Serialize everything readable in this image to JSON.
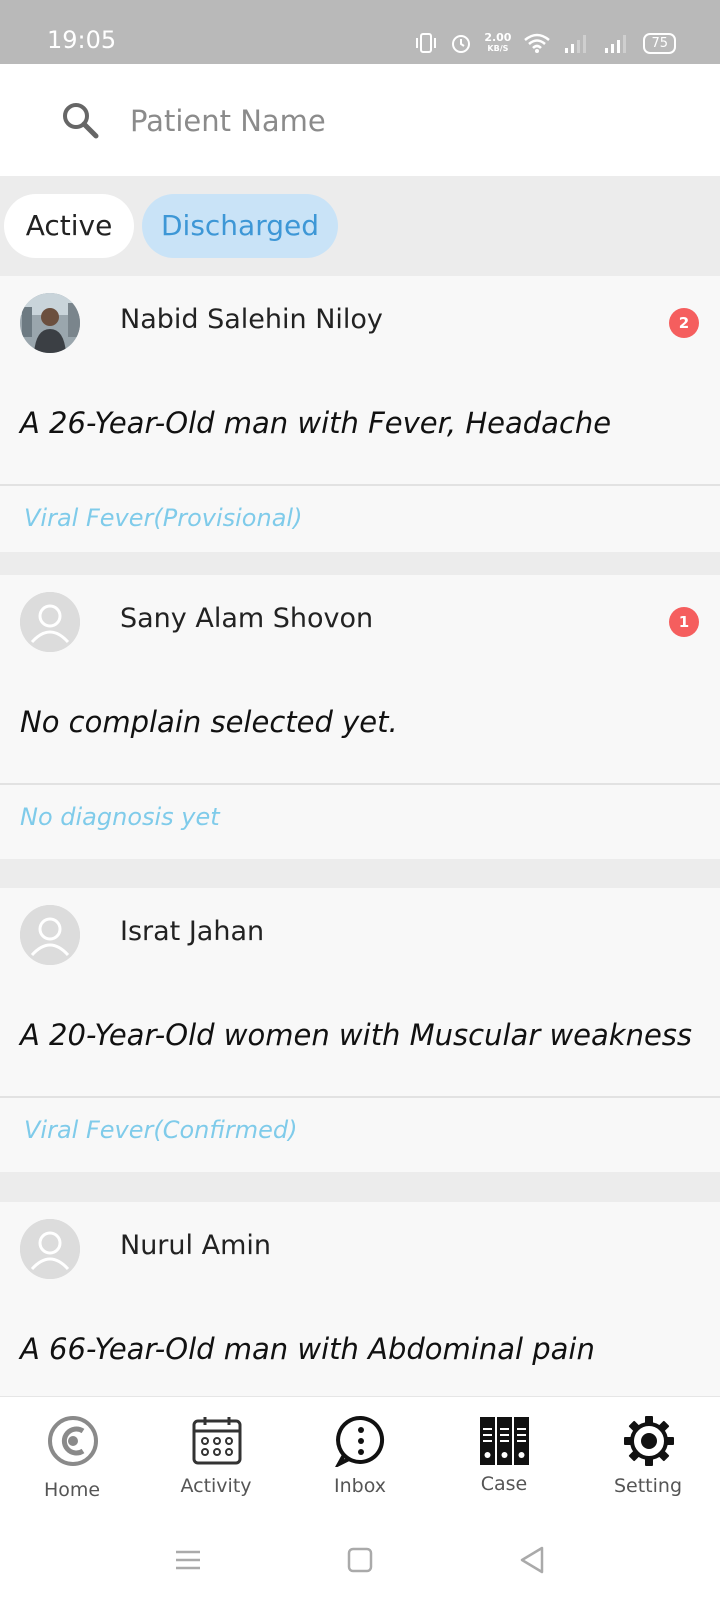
{
  "status": {
    "time": "19:05",
    "net_speed_value": "2.00",
    "net_speed_unit": "KB/S",
    "battery": "75"
  },
  "search": {
    "placeholder": "Patient Name"
  },
  "tabs": [
    {
      "label": "Active",
      "selected": false
    },
    {
      "label": "Discharged",
      "selected": true
    }
  ],
  "patients": [
    {
      "name": "Nabid Salehin Niloy",
      "badge": "2",
      "complaint": "A 26-Year-Old man with Fever, Headache",
      "diagnosis": "Viral Fever(Provisional)",
      "avatar": "photo"
    },
    {
      "name": "Sany Alam Shovon",
      "badge": "1",
      "complaint": "No complain selected yet.",
      "diagnosis": "No diagnosis yet",
      "avatar": "placeholder"
    },
    {
      "name": "Israt Jahan",
      "badge": "",
      "complaint": "A 20-Year-Old women with Muscular weakness",
      "diagnosis": "Viral Fever(Confirmed)",
      "avatar": "placeholder"
    },
    {
      "name": "Nurul Amin",
      "badge": "",
      "complaint": "A 66-Year-Old man with Abdominal pain",
      "diagnosis": "",
      "avatar": "placeholder"
    }
  ],
  "nav": [
    {
      "label": "Home",
      "icon": "home-logo-icon"
    },
    {
      "label": "Activity",
      "icon": "calendar-icon"
    },
    {
      "label": "Inbox",
      "icon": "chat-bubble-icon"
    },
    {
      "label": "Case",
      "icon": "binders-icon"
    },
    {
      "label": "Setting",
      "icon": "gear-icon"
    }
  ],
  "colors": {
    "accent": "#3d97d6",
    "tab_selected_bg": "#c9e3f7",
    "diagnosis_text": "#7fcbea",
    "badge": "#f55e5e"
  }
}
